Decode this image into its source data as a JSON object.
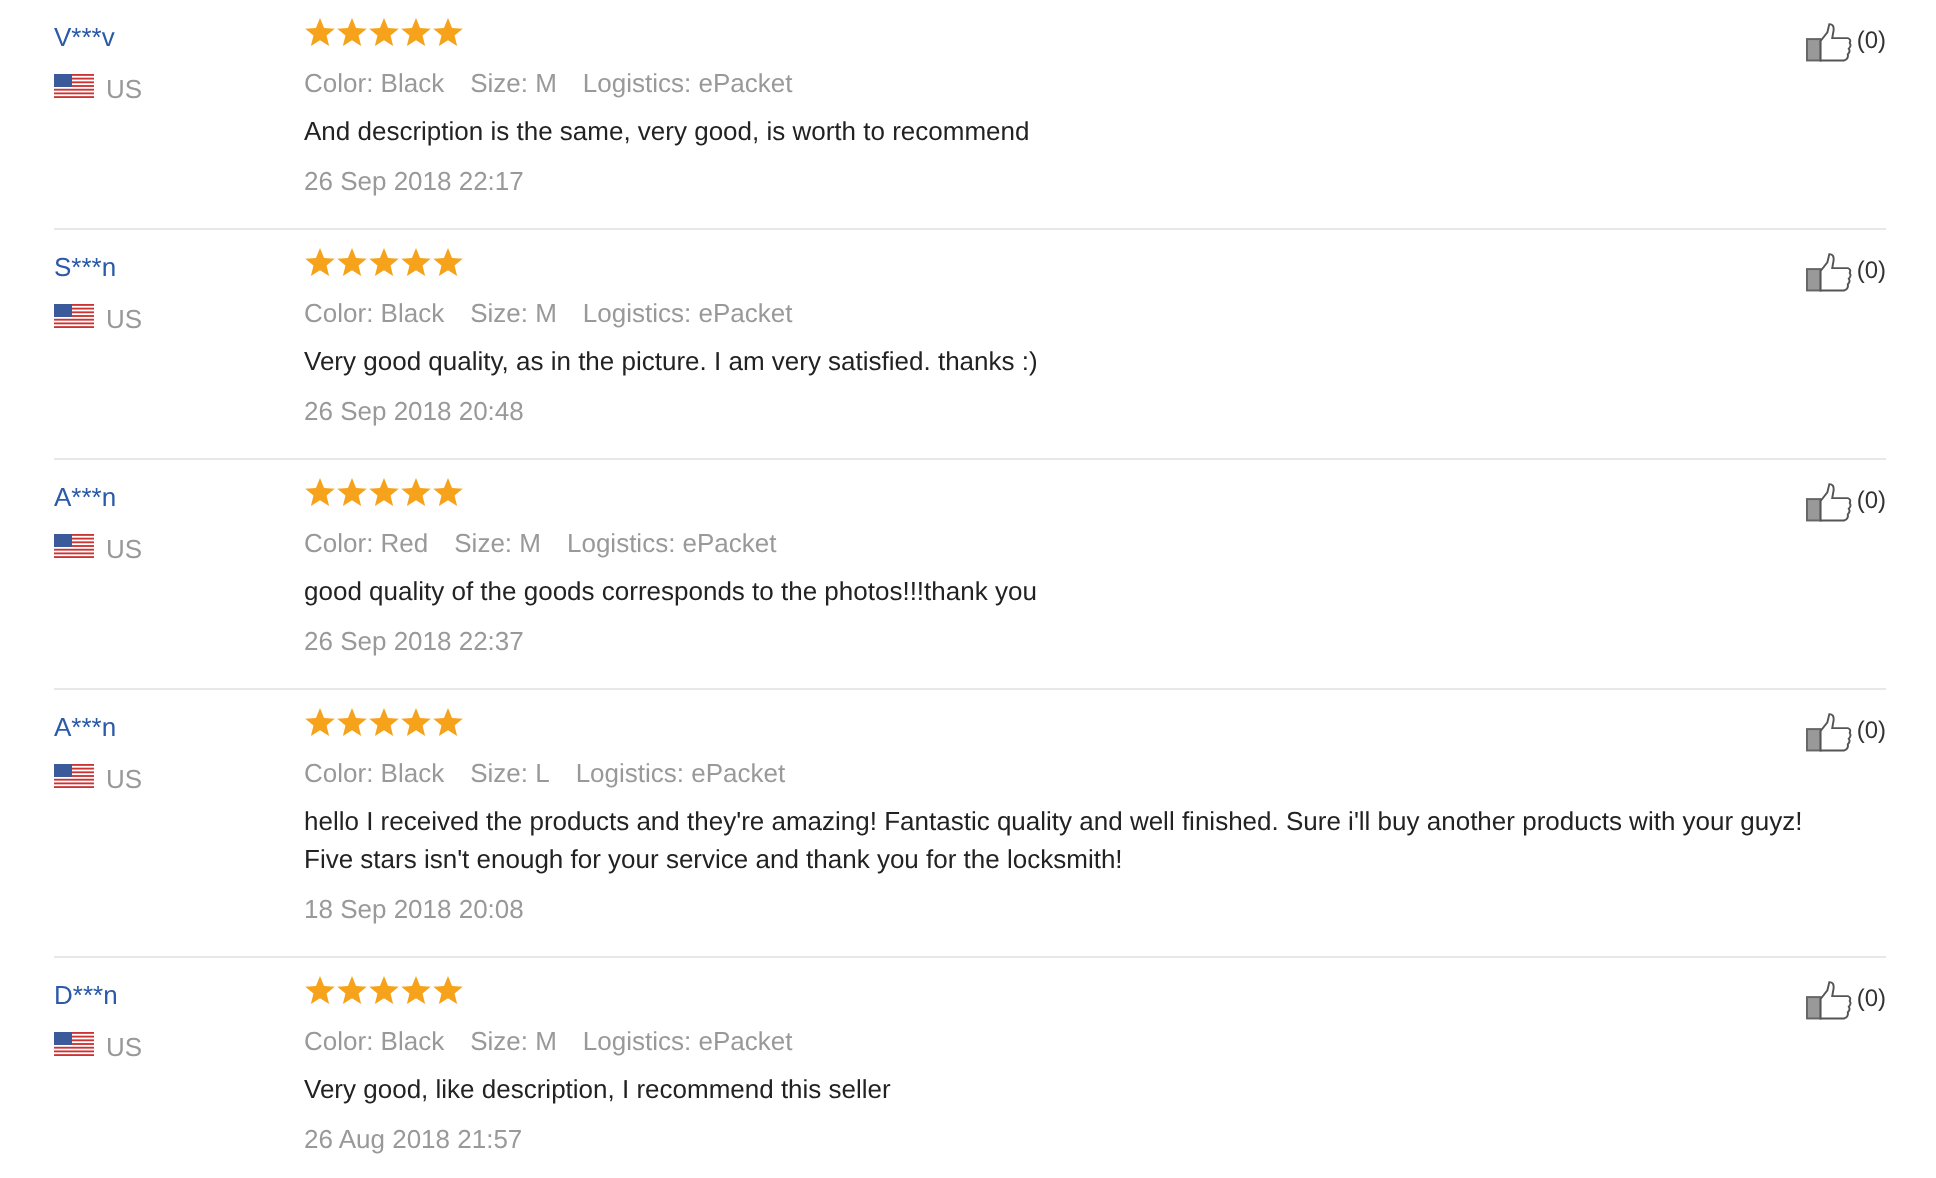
{
  "reviews": [
    {
      "user": "V***v",
      "country": "US",
      "stars": 5,
      "color_option": "Color: Black",
      "size": "Size: M",
      "logistics": "Logistics: ePacket",
      "text": "And description is the same, very good, is worth to recommend",
      "date": "26 Sep 2018 22:17",
      "likes": "(0)"
    },
    {
      "user": "S***n",
      "country": "US",
      "stars": 5,
      "color_option": "Color: Black",
      "size": "Size: M",
      "logistics": "Logistics: ePacket",
      "text": "Very good quality, as in the picture. I am very satisfied. thanks :)",
      "date": "26 Sep 2018 20:48",
      "likes": "(0)"
    },
    {
      "user": "A***n",
      "country": "US",
      "stars": 5,
      "color_option": "Color: Red",
      "size": "Size: M",
      "logistics": "Logistics: ePacket",
      "text": "good quality of the goods corresponds to the photos!!!thank you",
      "date": "26 Sep 2018 22:37",
      "likes": "(0)"
    },
    {
      "user": "A***n",
      "country": "US",
      "stars": 5,
      "color_option": "Color: Black",
      "size": "Size: L",
      "logistics": "Logistics: ePacket",
      "text": "hello I received the products and they're amazing! Fantastic quality and well finished. Sure i'll buy another products with your guyz! Five stars isn't enough for your service and thank you for the locksmith!",
      "date": "18 Sep 2018 20:08",
      "likes": "(0)"
    },
    {
      "user": "D***n",
      "country": "US",
      "stars": 5,
      "color_option": "Color: Black",
      "size": "Size: M",
      "logistics": "Logistics: ePacket",
      "text": "Very good, like description, I recommend this seller",
      "date": "26 Aug 2018 21:57",
      "likes": "(0)"
    }
  ]
}
